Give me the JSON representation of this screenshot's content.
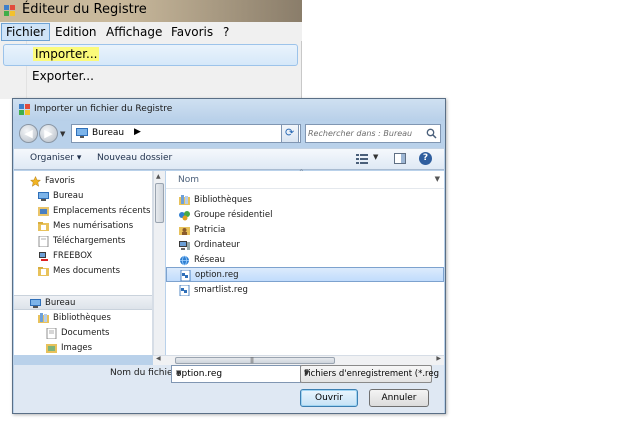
{
  "regedit": {
    "title": "Éditeur du Registre",
    "menu": {
      "fichier": "Fichier",
      "edition": "Edition",
      "affichage": "Affichage",
      "favoris": "Favoris",
      "help": "?"
    },
    "dropdown": {
      "importer": "Importer...",
      "exporter": "Exporter..."
    }
  },
  "dialog": {
    "title": "Importer un fichier du Registre",
    "address": {
      "current": "Bureau",
      "separator": "▶"
    },
    "search": {
      "placeholder": "Rechercher dans : Bureau"
    },
    "toolbar": {
      "organiser": "Organiser ▾",
      "new_folder": "Nouveau dossier"
    },
    "nav_tree": [
      {
        "label": "Favoris",
        "icon": "star-icon"
      },
      {
        "label": "Bureau",
        "icon": "desktop-icon"
      },
      {
        "label": "Emplacements récents",
        "icon": "recent-places-icon"
      },
      {
        "label": "Mes numérisations",
        "icon": "folder-icon"
      },
      {
        "label": "Téléchargements",
        "icon": "downloads-icon"
      },
      {
        "label": "FREEBOX",
        "icon": "network-device-icon"
      },
      {
        "label": "Mes documents",
        "icon": "documents-icon"
      },
      {
        "label": "Bureau",
        "icon": "desktop-icon"
      },
      {
        "label": "Bibliothèques",
        "icon": "libraries-icon"
      },
      {
        "label": "Documents",
        "icon": "documents-icon"
      },
      {
        "label": "Images",
        "icon": "images-icon"
      }
    ],
    "file_list": {
      "column": "Nom",
      "items": [
        {
          "label": "Bibliothèques",
          "icon": "libraries-icon"
        },
        {
          "label": "Groupe résidentiel",
          "icon": "homegroup-icon"
        },
        {
          "label": "Patricia",
          "icon": "user-folder-icon"
        },
        {
          "label": "Ordinateur",
          "icon": "computer-icon"
        },
        {
          "label": "Réseau",
          "icon": "network-icon"
        },
        {
          "label": "option.reg",
          "icon": "reg-file-icon"
        },
        {
          "label": "smartlist.reg",
          "icon": "reg-file-icon"
        }
      ],
      "selected": "option.reg"
    },
    "filename": {
      "label": "Nom du fichier :",
      "value": "option.reg"
    },
    "filetype": {
      "value": "Fichiers d'enregistrement (*.reg"
    },
    "buttons": {
      "open": "Ouvrir",
      "cancel": "Annuler"
    }
  },
  "colors": {
    "highlight_yellow": "#fbfa7a",
    "selection_blue": "#c1dcfc",
    "dialog_frame": "#b9d1ea"
  }
}
